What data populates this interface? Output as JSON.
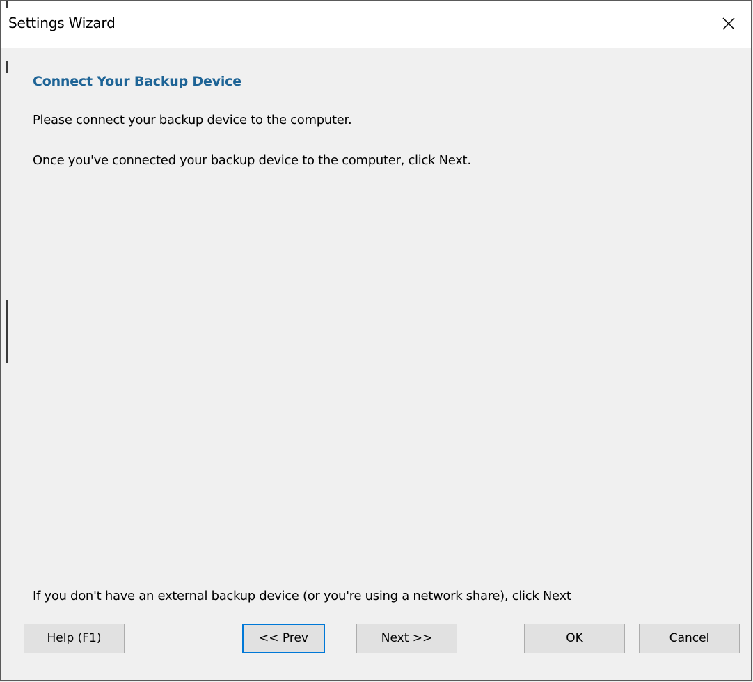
{
  "window": {
    "title": "Settings Wizard",
    "close_icon": "close-icon"
  },
  "content": {
    "heading": "Connect Your Backup Device",
    "instruction_1": "Please connect your backup device to the computer.",
    "instruction_2": "Once you've connected your backup device to the computer, click Next.",
    "footer_note": "If you don't have an external backup device (or you're using a network share), click Next"
  },
  "buttons": {
    "help": "Help (F1)",
    "prev": "<< Prev",
    "next": "Next >>",
    "ok": "OK",
    "cancel": "Cancel"
  },
  "colors": {
    "heading": "#1e6496",
    "focus_border": "#0078d7",
    "dialog_background": "#f0f0f0"
  }
}
